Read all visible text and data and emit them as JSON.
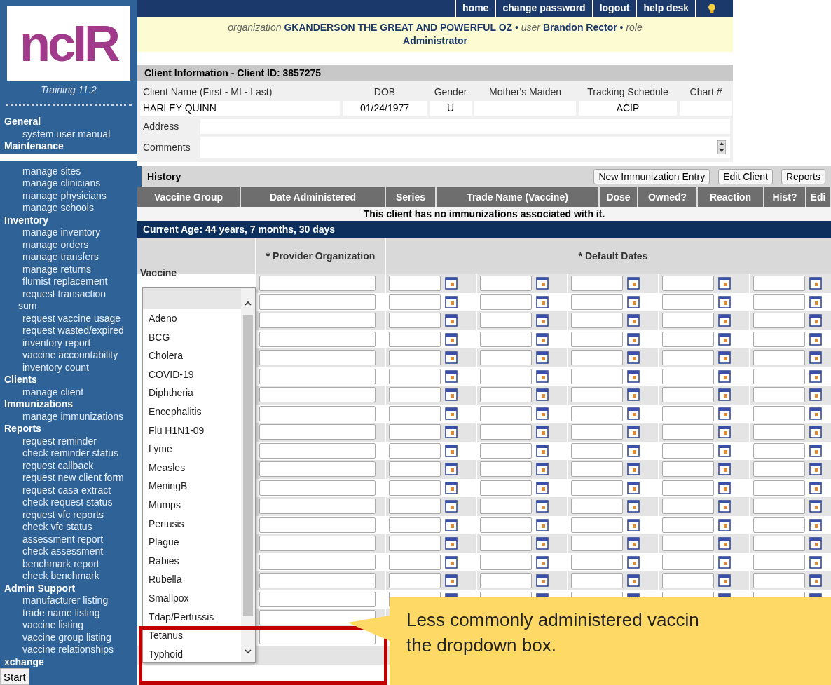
{
  "sidebar": {
    "logo": "ncIR",
    "version": "Training 11.2",
    "sections": [
      {
        "heading": "General",
        "kind": "full",
        "items": [
          {
            "label": "system user manual",
            "kind": "link"
          }
        ]
      },
      {
        "heading": "Maintenance",
        "kind": "cut",
        "items": [
          {
            "label": "manage sites",
            "kind": "link"
          },
          {
            "label": "manage clinicians",
            "kind": "link"
          },
          {
            "label": "manage physicians",
            "kind": "link"
          },
          {
            "label": "manage schools",
            "kind": "link"
          }
        ]
      },
      {
        "heading": "Inventory",
        "kind": "full",
        "items": [
          {
            "label": "manage inventory",
            "kind": "link"
          },
          {
            "label": "manage orders",
            "kind": "link"
          },
          {
            "label": "manage transfers",
            "kind": "link"
          },
          {
            "label": "manage returns",
            "kind": "link"
          },
          {
            "label": "flumist replacement",
            "kind": "link"
          },
          {
            "label": "request transaction",
            "kind": "link"
          },
          {
            "label": "sum",
            "kind": "wrap"
          },
          {
            "label": "request vaccine usage",
            "kind": "link"
          },
          {
            "label": "request wasted/expired",
            "kind": "link"
          },
          {
            "label": "inventory report",
            "kind": "link"
          },
          {
            "label": "vaccine accountability",
            "kind": "link"
          },
          {
            "label": "inventory count",
            "kind": "link"
          }
        ]
      },
      {
        "heading": "Clients",
        "kind": "full",
        "items": [
          {
            "label": "manage client",
            "kind": "link"
          }
        ]
      },
      {
        "heading": "Immunizations",
        "kind": "full",
        "items": [
          {
            "label": "manage immunizations",
            "kind": "link"
          }
        ]
      },
      {
        "heading": "Reports",
        "kind": "full",
        "items": [
          {
            "label": "request reminder",
            "kind": "link"
          },
          {
            "label": "check reminder status",
            "kind": "link"
          },
          {
            "label": "request callback",
            "kind": "link"
          },
          {
            "label": "request new client form",
            "kind": "link"
          },
          {
            "label": "request casa extract",
            "kind": "link"
          },
          {
            "label": "check request status",
            "kind": "link"
          },
          {
            "label": "request vfc reports",
            "kind": "link"
          },
          {
            "label": "check vfc status",
            "kind": "link"
          },
          {
            "label": "assessment report",
            "kind": "link"
          },
          {
            "label": "check assessment",
            "kind": "link"
          },
          {
            "label": "benchmark report",
            "kind": "link"
          },
          {
            "label": "check benchmark",
            "kind": "link"
          }
        ]
      },
      {
        "heading": "Admin Support",
        "kind": "full",
        "items": [
          {
            "label": "manufacturer listing",
            "kind": "link"
          },
          {
            "label": "trade name listing",
            "kind": "link"
          },
          {
            "label": "vaccine listing",
            "kind": "link"
          },
          {
            "label": "vaccine group listing",
            "kind": "link"
          },
          {
            "label": "vaccine relationships",
            "kind": "link"
          }
        ]
      },
      {
        "heading": "xchange",
        "kind": "full"
      }
    ]
  },
  "top_nav": [
    "home",
    "change password",
    "logout",
    "help desk"
  ],
  "user_info": "*organization*  **GKANDERSON THE GREAT AND POWERFUL OZ**  •  *user*  **Brandon Rector**  •  *role*  **Administrator**",
  "client_info": {
    "title": "Client Information   - Client ID:  3857275",
    "columns": [
      "Client Name (First - MI - Last)",
      "DOB",
      "Gender",
      "Mother's Maiden",
      "Tracking Schedule",
      "Chart #"
    ],
    "values": [
      {
        "kind": "text",
        "text": "HARLEY QUINN"
      },
      {
        "kind": "text",
        "text": "01/24/1977"
      },
      {
        "kind": "text",
        "text": "U"
      },
      {
        "kind": "blank"
      },
      {
        "kind": "text",
        "text": "ACIP"
      },
      {
        "kind": "blank"
      }
    ],
    "address_label": "Address",
    "comments_label": "Comments"
  },
  "history": {
    "title": "History",
    "buttons": [
      "New Immunization Entry",
      "Edit Client",
      "Reports"
    ],
    "columns": [
      "Vaccine Group",
      "Date Administered",
      "Series",
      "Trade Name (Vaccine)",
      "Dose",
      "Owned?",
      "Reaction",
      "Hist?",
      "Edi"
    ],
    "empty_message": "This client has no immunizations associated with it."
  },
  "current_age": "Current Age: 44 years, 7 months, 30 days",
  "entry_grid": {
    "provider_header": "* Provider Organization",
    "dates_header": "* Default Dates",
    "vaccine_label": "Vaccine",
    "rows": [
      {
        "kind": "entry"
      },
      {
        "kind": "entry"
      },
      {
        "kind": "entry"
      },
      {
        "kind": "entry"
      },
      {
        "kind": "entry"
      },
      {
        "kind": "entry"
      },
      {
        "kind": "entry"
      },
      {
        "kind": "entry"
      },
      {
        "kind": "entry"
      },
      {
        "kind": "entry"
      },
      {
        "kind": "entry"
      },
      {
        "kind": "entry"
      },
      {
        "kind": "entry"
      },
      {
        "kind": "entry"
      },
      {
        "kind": "entry"
      },
      {
        "kind": "entry"
      },
      {
        "kind": "entry"
      },
      {
        "kind": "entry"
      },
      {
        "kind": "entry"
      },
      {
        "kind": "entry"
      },
      {
        "kind": "select"
      }
    ]
  },
  "vaccine_dropdown": {
    "blank_option_highlighted": true,
    "options": [
      "Adeno",
      "BCG",
      "Cholera",
      "COVID-19",
      "Diphtheria",
      "Encephalitis",
      "Flu H1N1-09",
      "Lyme",
      "Measles",
      "MeningB",
      "Mumps",
      "Pertusis",
      "Plague",
      "Rabies",
      "Rubella",
      "Smallpox",
      "Tdap/Pertussis",
      "Tetanus",
      "Typhoid"
    ]
  },
  "callout": {
    "lines": [
      "Less commonly administered vaccin",
      "the dropdown box."
    ]
  },
  "taskbar": {
    "start": "Start"
  }
}
